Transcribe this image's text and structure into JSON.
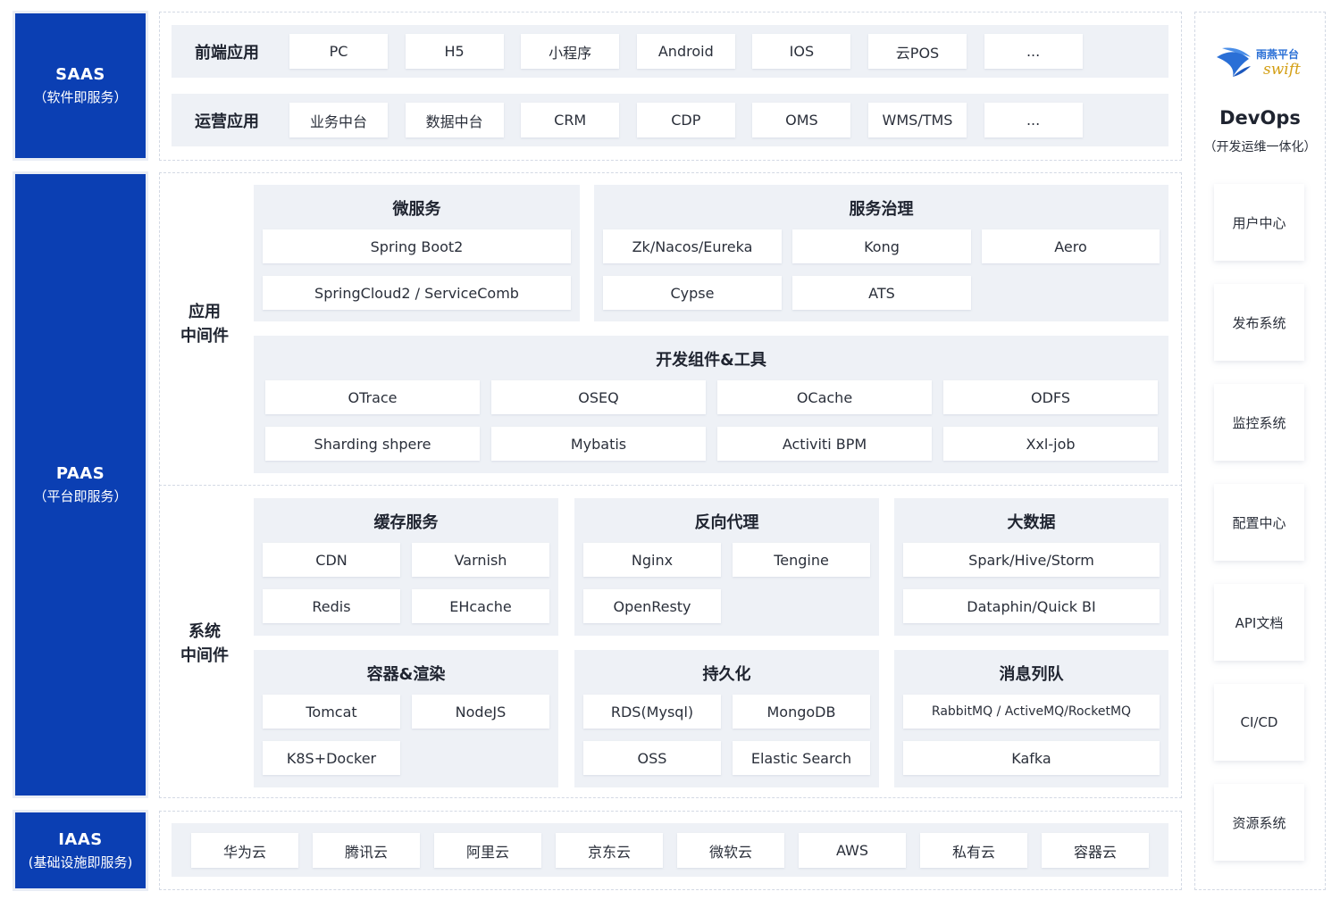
{
  "layers": {
    "saas": {
      "name": "SAAS",
      "desc": "（软件即服务）"
    },
    "paas": {
      "name": "PAAS",
      "desc": "（平台即服务）"
    },
    "iaas": {
      "name": "IAAS",
      "desc": "(基础设施即服务)"
    }
  },
  "saas": {
    "frontend": {
      "label": "前端应用",
      "items": [
        "PC",
        "H5",
        "小程序",
        "Android",
        "IOS",
        "云POS",
        "..."
      ]
    },
    "operation": {
      "label": "运营应用",
      "items": [
        "业务中台",
        "数据中台",
        "CRM",
        "CDP",
        "OMS",
        "WMS/TMS",
        "..."
      ]
    }
  },
  "paas": {
    "app_middleware": {
      "label_line1": "应用",
      "label_line2": "中间件"
    },
    "system_middleware": {
      "label_line1": "系统",
      "label_line2": "中间件"
    },
    "microservice": {
      "title": "微服务",
      "items": [
        "Spring Boot2",
        "SpringCloud2 / ServiceComb"
      ]
    },
    "governance": {
      "title": "服务治理",
      "items": [
        "Zk/Nacos/Eureka",
        "Kong",
        "Aero",
        "Cypse",
        "ATS"
      ]
    },
    "devtools": {
      "title": "开发组件&工具",
      "items": [
        "OTrace",
        "OSEQ",
        "OCache",
        "ODFS",
        "Sharding shpere",
        "Mybatis",
        "Activiti BPM",
        "Xxl-job"
      ]
    },
    "cache": {
      "title": "缓存服务",
      "items": [
        "CDN",
        "Varnish",
        "Redis",
        "EHcache"
      ]
    },
    "proxy": {
      "title": "反向代理",
      "items": [
        "Nginx",
        "Tengine",
        "OpenResty"
      ]
    },
    "bigdata": {
      "title": "大数据",
      "items": [
        "Spark/Hive/Storm",
        "Dataphin/Quick BI"
      ]
    },
    "container": {
      "title": "容器&渲染",
      "items": [
        "Tomcat",
        "NodeJS",
        "K8S+Docker"
      ]
    },
    "persistence": {
      "title": "持久化",
      "items": [
        "RDS(Mysql)",
        "MongoDB",
        "OSS",
        "Elastic Search"
      ]
    },
    "mq": {
      "title": "消息列队",
      "items": [
        "RabbitMQ / ActiveMQ/RocketMQ",
        "Kafka"
      ]
    }
  },
  "iaas": {
    "items": [
      "华为云",
      "腾讯云",
      "阿里云",
      "京东云",
      "微软云",
      "AWS",
      "私有云",
      "容器云"
    ]
  },
  "devops": {
    "logo_text": "雨燕平台",
    "logo_sub": "swift",
    "title": "DevOps",
    "subtitle": "（开发运维一体化）",
    "items": [
      "用户中心",
      "发布系统",
      "监控系统",
      "配置中心",
      "API文档",
      "CI/CD",
      "资源系统"
    ]
  },
  "colors": {
    "layer_blue": "#0b3fb3",
    "panel_gray": "#eef1f6",
    "logo_blue": "#2a6fd6",
    "logo_gold": "#d4a017"
  }
}
